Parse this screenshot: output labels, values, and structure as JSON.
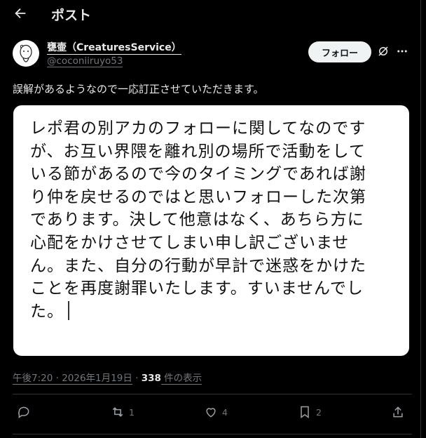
{
  "header": {
    "title": "ポスト"
  },
  "author": {
    "display_name": "甕壷（CreaturesService）",
    "handle": "@coconiiruyo53"
  },
  "follow_label": "フォロー",
  "post_text": "誤解があるようなので一応訂正させていただきます。",
  "image_text": "レポ君の別アカのフォローに関してなのですが、お互い界隈を離れ別の場所で活動をしている節があるので今のタイミングであれば謝り仲を戻せるのではと思いフォローした次第であります。決して他意はなく、あちら方に心配をかけさせてしまい申し訳ございません。また、自分の行動が早計で迷惑をかけたことを再度謝罪いたします。すいませんでした。",
  "image_lines": [
    "レポ君の別アカのフォローに関してなのです",
    "が、お互い界隈を離れ別の場所で活動をして",
    "いる節があるので今のタイミングであれば謝",
    "り仲を戻せるのではと思いフォローした次第",
    "であります。決して他意はなく、あちら方に",
    "心配をかけさせてしまい申し訳ございませ",
    "ん。また、自分の行動が早計で迷惑をかけた",
    "ことを再度謝罪いたします。すいませんでし",
    "た。"
  ],
  "meta": {
    "time": "午後7:20 · 2026年1月19日",
    "sep": " · ",
    "views": "338",
    "views_label": " 件の表示"
  },
  "actions": {
    "reply_count": "",
    "repost_count": "1",
    "like_count": "4",
    "bookmark_count": "2"
  },
  "icons": {
    "back": "arrow-left-icon",
    "grok": "grok-icon",
    "more": "more-dots-icon",
    "reply": "reply-icon",
    "repost": "repost-icon",
    "like": "heart-icon",
    "bookmark": "bookmark-icon",
    "share": "share-icon"
  }
}
